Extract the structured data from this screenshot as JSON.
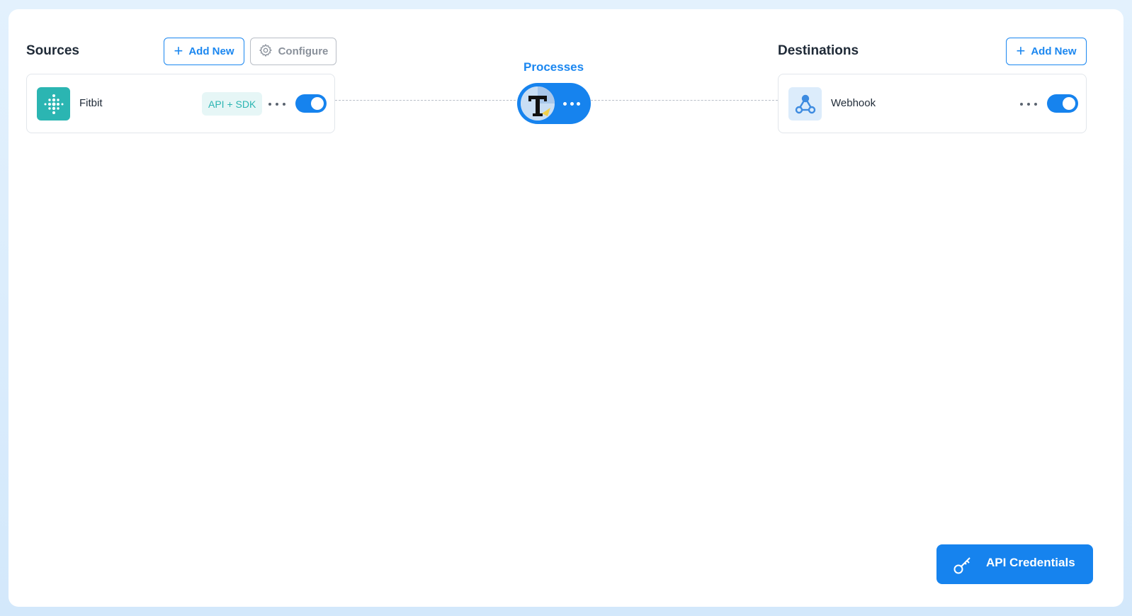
{
  "sources": {
    "title": "Sources",
    "add_label": "Add New",
    "configure_label": "Configure",
    "items": [
      {
        "name": "Fitbit",
        "tag": "API + SDK",
        "enabled": true,
        "logo_color": "#2bb5b2"
      }
    ]
  },
  "processes": {
    "title": "Processes"
  },
  "destinations": {
    "title": "Destinations",
    "add_label": "Add New",
    "items": [
      {
        "name": "Webhook",
        "enabled": true,
        "logo_bg": "#dcecfb",
        "logo_color": "#3d8be0"
      }
    ]
  },
  "footer": {
    "credentials_label": "API Credentials"
  },
  "colors": {
    "accent": "#1683ee",
    "tag_bg": "#e6f6f6",
    "tag_text": "#2bb5b2",
    "page_bg": "#d9ecfd"
  }
}
